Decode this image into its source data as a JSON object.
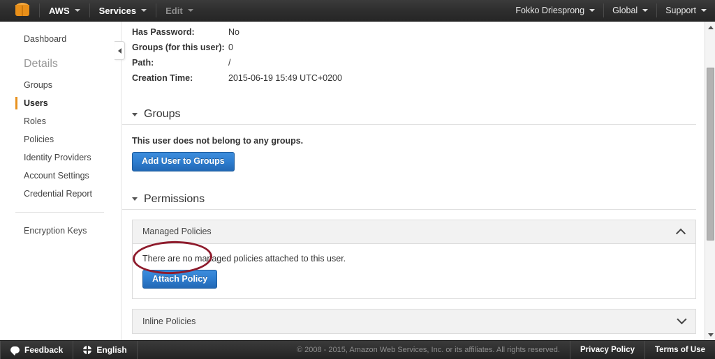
{
  "topnav": {
    "logo_name": "aws-cube-logo",
    "left_items": [
      {
        "label": "AWS",
        "disabled": false
      },
      {
        "label": "Services",
        "disabled": false
      },
      {
        "label": "Edit",
        "disabled": true
      }
    ],
    "right_items": [
      {
        "label": "Fokko Driesprong"
      },
      {
        "label": "Global"
      },
      {
        "label": "Support"
      }
    ]
  },
  "sidebar": {
    "items": [
      {
        "label": "Dashboard",
        "type": "link",
        "active": false
      },
      {
        "label": "Details",
        "type": "header",
        "active": false
      },
      {
        "label": "Groups",
        "type": "link",
        "active": false
      },
      {
        "label": "Users",
        "type": "link",
        "active": true
      },
      {
        "label": "Roles",
        "type": "link",
        "active": false
      },
      {
        "label": "Policies",
        "type": "link",
        "active": false
      },
      {
        "label": "Identity Providers",
        "type": "link",
        "active": false
      },
      {
        "label": "Account Settings",
        "type": "link",
        "active": false
      },
      {
        "label": "Credential Report",
        "type": "link",
        "active": false
      },
      {
        "label": "Encryption Keys",
        "type": "link",
        "active": false
      }
    ]
  },
  "details": {
    "rows": [
      {
        "label": "Has Password:",
        "value": "No"
      },
      {
        "label": "Groups (for this user):",
        "value": "0"
      },
      {
        "label": "Path:",
        "value": "/"
      },
      {
        "label": "Creation Time:",
        "value": "2015-06-19 15:49 UTC+0200"
      }
    ]
  },
  "groups_section": {
    "title": "Groups",
    "note": "This user does not belong to any groups.",
    "button_label": "Add User to Groups"
  },
  "permissions_section": {
    "title": "Permissions",
    "managed": {
      "title": "Managed Policies",
      "expanded": true,
      "note": "There are no managed policies attached to this user.",
      "button_label": "Attach Policy"
    },
    "inline": {
      "title": "Inline Policies",
      "expanded": false
    }
  },
  "annotation": {
    "target": "Attach Policy",
    "shape": "ellipse",
    "color": "#8e1b2c"
  },
  "footer": {
    "feedback_label": "Feedback",
    "language_label": "English",
    "copyright": "© 2008 - 2015, Amazon Web Services, Inc. or its affiliates. All rights reserved.",
    "privacy_label": "Privacy Policy",
    "terms_label": "Terms of Use"
  },
  "colors": {
    "accent_orange": "#e8921f",
    "button_blue": "#2f7fd1",
    "annotation_red": "#8e1b2c",
    "nav_dark": "#2e2e2e"
  }
}
